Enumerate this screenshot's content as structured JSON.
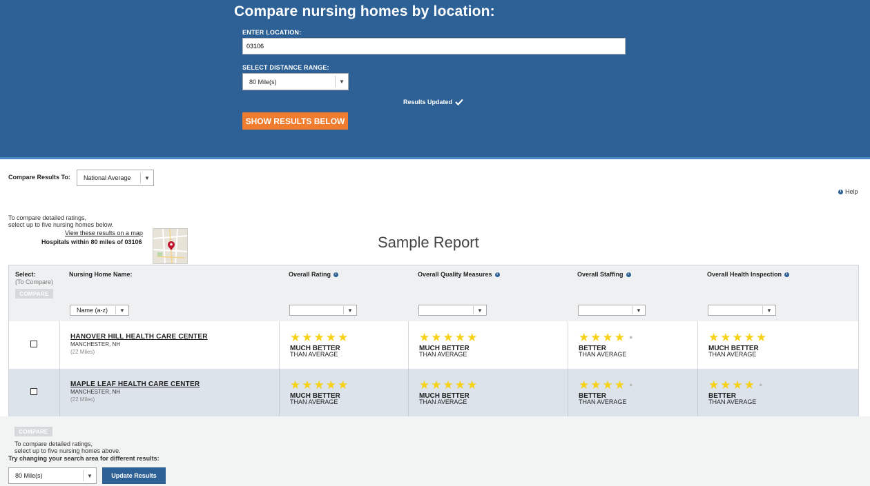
{
  "header": {
    "title": "Compare nursing homes by location:",
    "location_label": "ENTER LOCATION:",
    "location_value": "03106",
    "distance_label": "SELECT DISTANCE RANGE:",
    "distance_value": "80 Mile(s)",
    "results_updated": "Results Updated",
    "show_results_label": "SHOW RESULTS BELOW"
  },
  "compare_to": {
    "label": "Compare Results To:",
    "value": "National Average"
  },
  "help_label": "Help",
  "notes": {
    "top_line1": "To compare detailed ratings,",
    "top_line2": "select up to five nursing homes below.",
    "map_link": "View these results on a map",
    "hospitals": "Hospitals within 80 miles of 03106",
    "sample_report": "Sample Report"
  },
  "table": {
    "select_header": "Select:",
    "select_sub": "(To Compare)",
    "compare_label": "COMPARE",
    "name_header": "Nursing Home Name:",
    "name_sort_value": "Name (a-z)",
    "columns": [
      "Overall Rating",
      "Overall Quality Measures",
      "Overall Staffing",
      "Overall Health Inspection"
    ],
    "rows": [
      {
        "name": "HANOVER HILL HEALTH CARE CENTER",
        "city": "MANCHESTER, NH",
        "miles": "(22 Miles)",
        "ratings": [
          {
            "stars": 5,
            "line1": "MUCH BETTER",
            "line2": "THAN AVERAGE"
          },
          {
            "stars": 5,
            "line1": "MUCH BETTER",
            "line2": "THAN AVERAGE"
          },
          {
            "stars": 4,
            "line1": "BETTER",
            "line2": "THAN AVERAGE"
          },
          {
            "stars": 5,
            "line1": "MUCH BETTER",
            "line2": "THAN AVERAGE"
          }
        ]
      },
      {
        "name": "MAPLE LEAF HEALTH CARE CENTER",
        "city": "MANCHESTER, NH",
        "miles": "(22 Miles)",
        "ratings": [
          {
            "stars": 5,
            "line1": "MUCH BETTER",
            "line2": "THAN AVERAGE"
          },
          {
            "stars": 5,
            "line1": "MUCH BETTER",
            "line2": "THAN AVERAGE"
          },
          {
            "stars": 4,
            "line1": "BETTER",
            "line2": "THAN AVERAGE"
          },
          {
            "stars": 4,
            "line1": "BETTER",
            "line2": "THAN AVERAGE"
          }
        ]
      }
    ]
  },
  "bottom": {
    "compare_label": "COMPARE",
    "note_line1": "To compare detailed ratings,",
    "note_line2": "select up to five nursing homes above.",
    "try_changing": "Try changing your search area for different results:",
    "distance_value": "80 Mile(s)",
    "update_label": "Update Results"
  },
  "colors": {
    "header_bg": "#2d6196",
    "accent_orange": "#f07c2f",
    "star": "#f7d116",
    "alt_row": "#dce3ea"
  }
}
